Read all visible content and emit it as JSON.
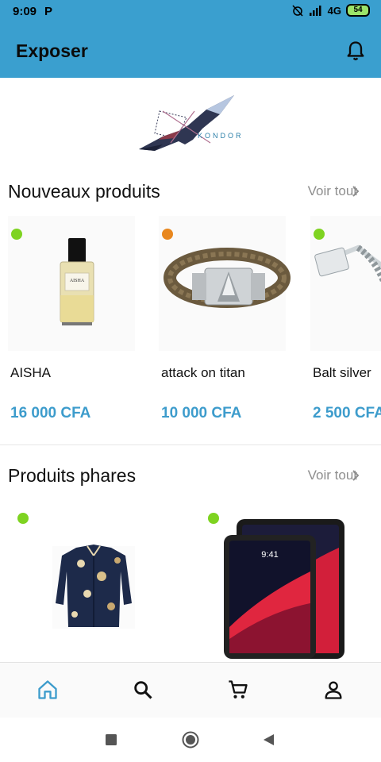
{
  "status_bar": {
    "time": "9:09",
    "carrier_icon": "P",
    "network": "4G",
    "battery": "54"
  },
  "app_bar": {
    "title": "Exposer",
    "bell_icon": "bell-icon"
  },
  "logo": {
    "text": "KONDOR"
  },
  "new_products": {
    "title": "Nouveaux produits",
    "see_all": "Voir tout",
    "items": [
      {
        "name": "AISHA",
        "price": "16 000 CFA",
        "status_color": "#7ed321",
        "label_on_bottle": "AISHA"
      },
      {
        "name": "attack on titan",
        "price": "10 000 CFA",
        "status_color": "#e8871e"
      },
      {
        "name": "Balt silver",
        "price": "2 500 CFA",
        "status_color": "#7ed321"
      }
    ]
  },
  "featured_products": {
    "title": "Produits phares",
    "see_all": "Voir tout",
    "items": [
      {
        "status_color": "#7ed321"
      },
      {
        "status_color": "#7ed321",
        "screen_time": "9:41"
      }
    ]
  },
  "bottom_nav": {
    "items": [
      "home-icon",
      "search-icon",
      "cart-icon",
      "profile-icon"
    ],
    "active_color": "#3d9ccc"
  }
}
